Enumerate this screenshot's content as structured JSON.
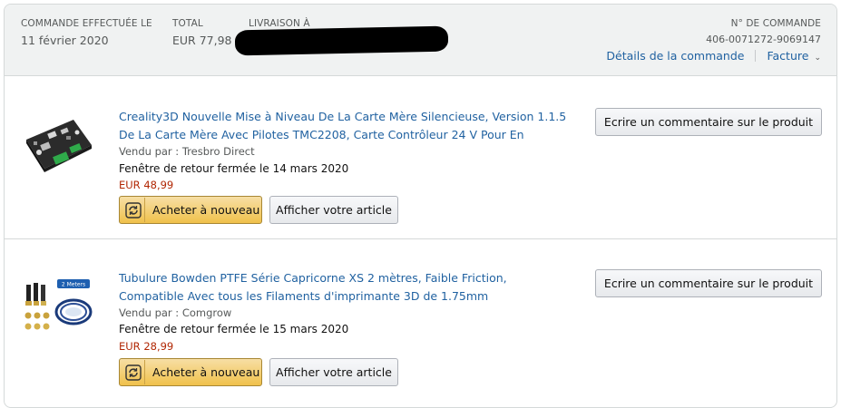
{
  "header": {
    "order_placed_label": "COMMANDE EFFECTUÉE LE",
    "order_placed_value": "11 février 2020",
    "total_label": "TOTAL",
    "total_value": "EUR 77,98",
    "ship_to_label": "LIVRAISON À",
    "order_number_label": "N° DE COMMANDE",
    "order_number_value": "406-0071272-9069147",
    "details_link": "Détails de la commande",
    "invoice_link": "Facture"
  },
  "items": [
    {
      "title": "Creality3D Nouvelle Mise à Niveau De La Carte Mère Silencieuse, Version 1.1.5 De La Carte Mère Avec Pilotes TMC2208, Carte Contrôleur 24 V Pour En",
      "seller": "Vendu par : Tresbro Direct",
      "return_window": "Fenêtre de retour fermée le 14 mars 2020",
      "price": "EUR 48,99",
      "buy_again": "Acheter à nouveau",
      "view_item": "Afficher votre article",
      "review": "Ecrire un commentaire sur le produit",
      "icon": "circuit-board-icon"
    },
    {
      "title": "Tubulure Bowden PTFE Série Capricorne XS 2 mètres, Faible Friction, Compatible Avec tous les Filaments d'imprimante 3D de 1.75mm",
      "seller": "Vendu par : Comgrow",
      "return_window": "Fenêtre de retour fermée le 15 mars 2020",
      "price": "EUR 28,99",
      "buy_again": "Acheter à nouveau",
      "view_item": "Afficher votre article",
      "review": "Ecrire un commentaire sur le produit",
      "image_badge": "2 Meters",
      "icon": "ptfe-tube-kit-icon"
    }
  ],
  "colors": {
    "link": "#2162a1",
    "price": "#b12704",
    "header_bg": "#f0f2f2",
    "buy_button": "#f0c14b"
  }
}
